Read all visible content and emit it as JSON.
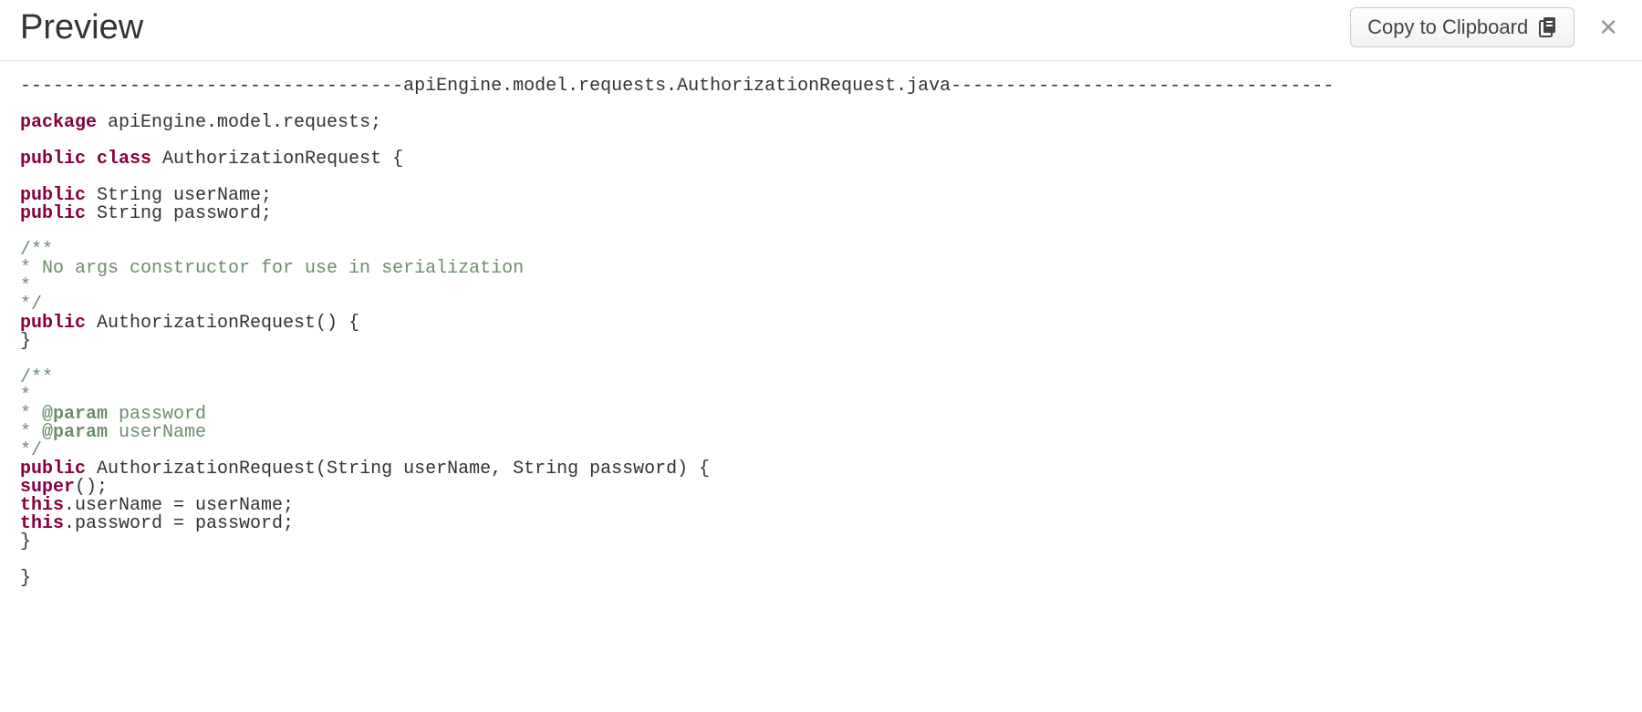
{
  "header": {
    "title": "Preview",
    "copy_label": "Copy to Clipboard"
  },
  "code": {
    "divider": "-----------------------------------apiEngine.model.requests.AuthorizationRequest.java-----------------------------------",
    "kw_package": "package",
    "pkg_rest": " apiEngine.model.requests;",
    "kw_public1": "public",
    "kw_class": "class",
    "class_rest": " AuthorizationRequest {",
    "kw_public2": "public",
    "field1_rest": " String userName;",
    "kw_public3": "public",
    "field2_rest": " String password;",
    "cm1_l1": "/**",
    "cm1_l2": "* No args constructor for use in serialization",
    "cm1_l3": "*",
    "cm1_l4": "*/",
    "kw_public4": "public",
    "ctor1_rest": " AuthorizationRequest() {",
    "brace1": "}",
    "cm2_l1": "/**",
    "cm2_l2": "*",
    "cm2_l3_star": "* ",
    "cm2_l3_tag": "@param",
    "cm2_l3_rest": " password",
    "cm2_l4_star": "* ",
    "cm2_l4_tag": "@param",
    "cm2_l4_rest": " userName",
    "cm2_l5": "*/",
    "kw_public5": "public",
    "ctor2_rest": " AuthorizationRequest(String userName, String password) {",
    "kw_super": "super",
    "super_rest": "();",
    "kw_this1": "this",
    "assign1_rest": ".userName = userName;",
    "kw_this2": "this",
    "assign2_rest": ".password = password;",
    "brace2": "}",
    "brace3": "}"
  }
}
